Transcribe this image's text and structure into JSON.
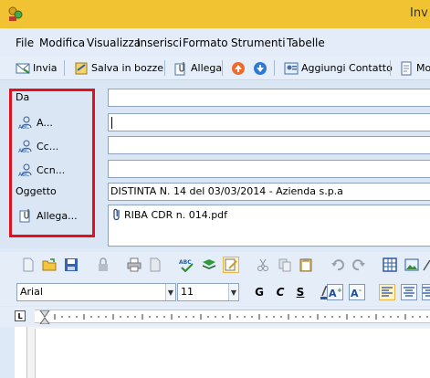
{
  "window": {
    "title": "Inv"
  },
  "menu": [
    "File",
    "Modifica",
    "Visualizza",
    "Inserisci",
    "Formato",
    "Strumenti",
    "Tabelle"
  ],
  "toolbar": {
    "send": "Invia",
    "save_draft": "Salva in bozze",
    "attach": "Allega",
    "add_contact": "Aggiungi Contatto",
    "more": "Mo"
  },
  "fields": {
    "from": {
      "label": "Da",
      "value": ""
    },
    "to": {
      "label": "A...",
      "value": ""
    },
    "cc": {
      "label": "Cc...",
      "value": ""
    },
    "bcc": {
      "label": "Ccn...",
      "value": ""
    },
    "subject": {
      "label": "Oggetto",
      "value": "DISTINTA N. 14 del 03/03/2014 - Azienda s.p.a"
    },
    "attachments": {
      "label": "Allega...",
      "files": [
        "RIBA CDR n. 014.pdf"
      ]
    }
  },
  "format": {
    "font": "Arial",
    "size": "11",
    "bold_label": "G",
    "italic_label": "C",
    "underline_label": "S"
  },
  "ruler": {
    "corner": "L"
  },
  "colors": {
    "highlight_frame": "#e0101c",
    "title_bar": "#f1c232"
  }
}
